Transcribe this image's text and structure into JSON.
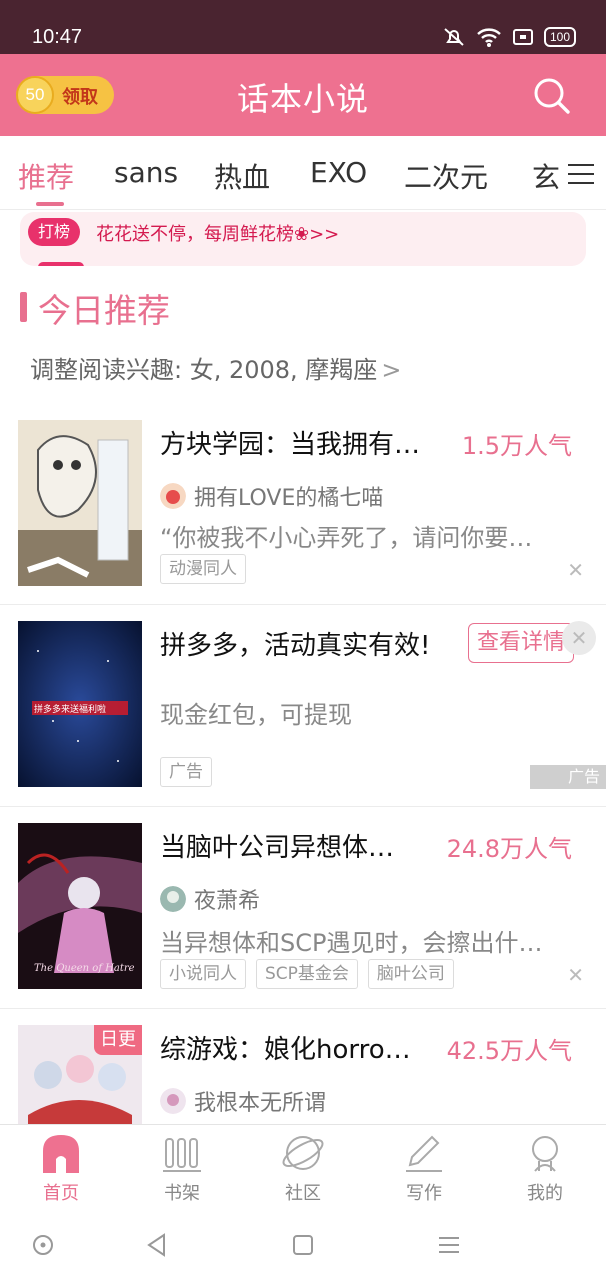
{
  "status_bar": {
    "time": "10:47",
    "battery": "100"
  },
  "header": {
    "coins": "50",
    "claim_label": "领取",
    "title": "话本小说"
  },
  "tabs": [
    {
      "label": "推荐",
      "active": true
    },
    {
      "label": "sans"
    },
    {
      "label": "热血"
    },
    {
      "label": "EXO"
    },
    {
      "label": "二次元"
    },
    {
      "label": "玄"
    }
  ],
  "banner": {
    "badge": "打榜",
    "text": "花花送不停，每周鲜花榜❀>>"
  },
  "section": {
    "title": "今日推荐",
    "interest": "调整阅读兴趣: 女, 2008, 摩羯座"
  },
  "books": [
    {
      "title": "方块学园：当我拥有…",
      "popularity": "1.5万人气",
      "author": "拥有LOVE的橘七喵",
      "desc": "“你被我不小心弄死了，请问你要…",
      "tags": [
        "动漫同人"
      ]
    },
    {
      "title": "当脑叶公司异想体…",
      "popularity": "24.8万人气",
      "author": "夜萧希",
      "desc": "当异想体和SCP遇见时，会擦出什…",
      "tags": [
        "小说同人",
        "SCP基金会",
        "脑叶公司"
      ]
    },
    {
      "title": "综游戏：娘化horro…",
      "popularity": "42.5万人气",
      "author": "我根本无所谓",
      "badge": "日更"
    }
  ],
  "ad": {
    "title": "拼多多，活动真实有效!",
    "subtitle": "现金红包，可提现",
    "button": "查看详情",
    "tag": "广告",
    "mark": "广告",
    "cover_text": "拼多多来送福利啦"
  },
  "cover_texts": {
    "book2": "The Queen of Hatred"
  },
  "bottom_nav": [
    {
      "label": "首页",
      "icon": "home-icon",
      "active": true
    },
    {
      "label": "书架",
      "icon": "bookshelf-icon"
    },
    {
      "label": "社区",
      "icon": "community-planet-icon"
    },
    {
      "label": "写作",
      "icon": "write-pencil-icon"
    },
    {
      "label": "我的",
      "icon": "profile-icon"
    }
  ],
  "colors": {
    "accent": "#e8708f",
    "header_bg": "#ee7190",
    "status_bg": "#4a2430"
  }
}
